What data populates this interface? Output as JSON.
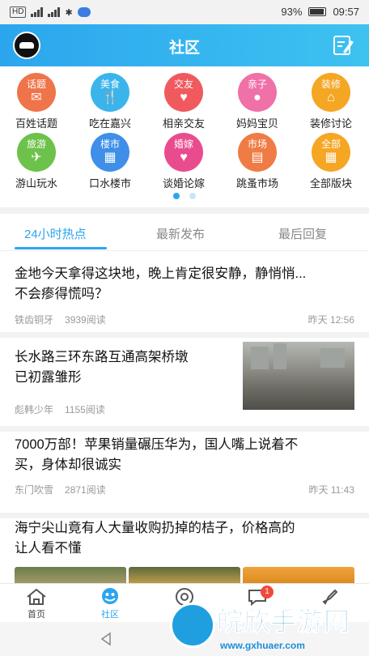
{
  "status_bar": {
    "left_chip": "HD",
    "battery": "93%",
    "time": "09:57"
  },
  "header": {
    "title": "社区",
    "avatar_icon": "car-avatar-icon",
    "action_icon": "edit-icon"
  },
  "categories": [
    {
      "badge": "话题",
      "glyph": "✉",
      "label": "百姓话题",
      "color": "#f0744a"
    },
    {
      "badge": "美食",
      "glyph": "🍴",
      "label": "吃在嘉兴",
      "color": "#3bb4ec"
    },
    {
      "badge": "交友",
      "glyph": "♥",
      "label": "相亲交友",
      "color": "#f05a5f"
    },
    {
      "badge": "亲子",
      "glyph": "●",
      "label": "妈妈宝贝",
      "color": "#f070a8"
    },
    {
      "badge": "装修",
      "glyph": "⌂",
      "label": "装修讨论",
      "color": "#f5a623"
    },
    {
      "badge": "旅游",
      "glyph": "✈",
      "label": "游山玩水",
      "color": "#6cc24a"
    },
    {
      "badge": "楼市",
      "glyph": "▦",
      "label": "口水楼市",
      "color": "#3f8fe8"
    },
    {
      "badge": "婚嫁",
      "glyph": "♥",
      "label": "谈婚论嫁",
      "color": "#e94c8e"
    },
    {
      "badge": "市场",
      "glyph": "▤",
      "label": "跳蚤市场",
      "color": "#f07c45"
    },
    {
      "badge": "全部",
      "glyph": "▦",
      "label": "全部版块",
      "color": "#f5a623"
    }
  ],
  "tabs": [
    {
      "label": "24小时热点",
      "active": true
    },
    {
      "label": "最新发布",
      "active": false
    },
    {
      "label": "最后回复",
      "active": false
    }
  ],
  "posts": [
    {
      "title_line1": "金地今天拿得这块地，晚上肯定很安静，静悄悄...",
      "title_line2": "不会瘆得慌吗？",
      "author": "铁齿铜牙",
      "reads": "3939阅读",
      "time": "昨天 12:56"
    },
    {
      "title_line1": "长水路三环东路互通高架桥墩",
      "title_line2": "已初露雏形",
      "author": "彪韩少年",
      "reads": "1155阅读",
      "time": ""
    },
    {
      "title_line1": "7000万部！苹果销量碾压华为，国人嘴上说着不",
      "title_line2": "买，身体却很诚实",
      "author": "东门吹雪",
      "reads": "2871阅读",
      "time": "昨天 11:43"
    },
    {
      "title_line1": "海宁尖山竟有人大量收购扔掉的桔子，价格高的",
      "title_line2": "让人看不懂",
      "author": "",
      "reads": "",
      "time": ""
    }
  ],
  "bottom_nav": [
    {
      "label": "首页",
      "icon": "home-icon",
      "active": false
    },
    {
      "label": "社区",
      "icon": "community-icon",
      "active": true
    },
    {
      "label": "",
      "icon": "camera-icon",
      "active": false
    },
    {
      "label": "",
      "icon": "message-icon",
      "active": false,
      "badge": "1"
    },
    {
      "label": "",
      "icon": "rocket-icon",
      "active": false
    }
  ],
  "watermark": {
    "title": "皖欣手游网",
    "url": "www.gxhuaer.com"
  },
  "colors": {
    "accent": "#2ba6ee",
    "badge_red": "#f04a3a"
  }
}
